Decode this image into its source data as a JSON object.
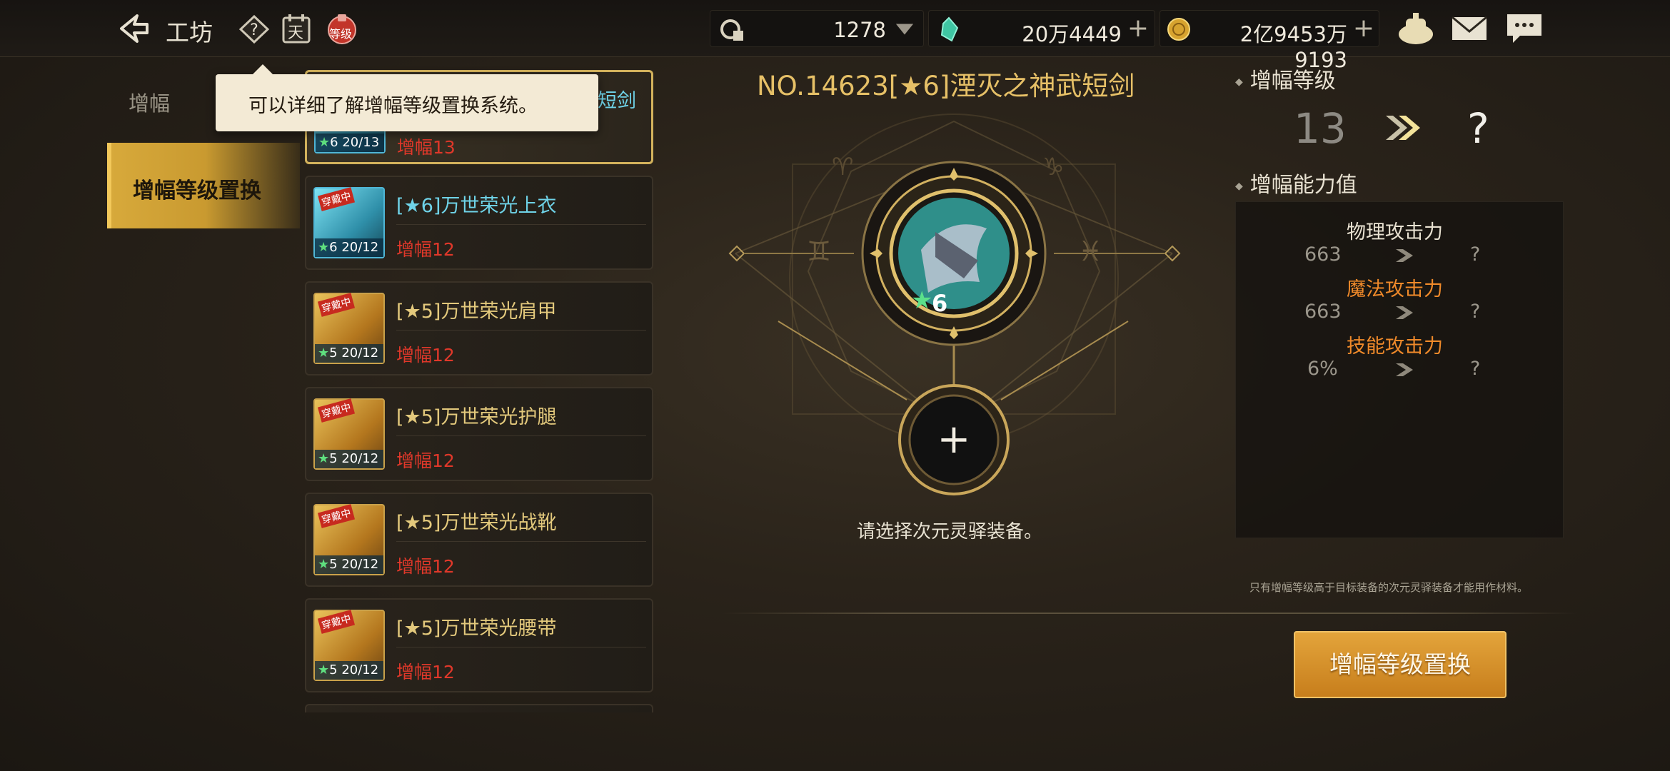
{
  "header": {
    "title": "工坊",
    "level_badge": "等级",
    "calendar_glyph": "天",
    "resources": [
      {
        "icon": "ticket-icon",
        "value": "1278"
      },
      {
        "icon": "crystal-icon",
        "value": "20万4449"
      },
      {
        "icon": "gold-coin-icon",
        "value": "2亿9453万9193"
      }
    ]
  },
  "tooltip": {
    "text": "可以详细了解增幅等级置换系统。"
  },
  "menu": {
    "tabs": [
      {
        "label": "增幅",
        "active": false
      },
      {
        "label": "增幅等级置换",
        "active": true
      }
    ]
  },
  "equipment_list": [
    {
      "name": "武短剑",
      "level": "增幅13",
      "stars": "6",
      "progress": "20/13",
      "frame": "blue",
      "selected": true
    },
    {
      "name": "[★6]万世荣光上衣",
      "level": "增幅12",
      "stars": "6",
      "progress": "20/12",
      "frame": "blue",
      "tag": "穿戴中",
      "selected": false
    },
    {
      "name": "[★5]万世荣光肩甲",
      "level": "增幅12",
      "stars": "5",
      "progress": "20/12",
      "frame": "gold",
      "tag": "穿戴中",
      "selected": false
    },
    {
      "name": "[★5]万世荣光护腿",
      "level": "增幅12",
      "stars": "5",
      "progress": "20/12",
      "frame": "gold",
      "tag": "穿戴中",
      "selected": false
    },
    {
      "name": "[★5]万世荣光战靴",
      "level": "增幅12",
      "stars": "5",
      "progress": "20/12",
      "frame": "gold",
      "tag": "穿戴中",
      "selected": false
    },
    {
      "name": "[★5]万世荣光腰带",
      "level": "增幅12",
      "stars": "5",
      "progress": "20/12",
      "frame": "gold",
      "tag": "穿戴中",
      "selected": false
    }
  ],
  "center": {
    "item_title": "NO.14623[★6]湮灭之神武短剑",
    "item_stars": "6",
    "add_symbol": "+",
    "prompt": "请选择次元灵驿装备。"
  },
  "right": {
    "level_heading": "增幅等级",
    "current_level": "13",
    "next_level": "?",
    "ability_heading": "增幅能力值",
    "stats": [
      {
        "label": "物理攻击力",
        "value": "663",
        "next": "?",
        "color": "#e9e2d2"
      },
      {
        "label": "魔法攻击力",
        "value": "663",
        "next": "?",
        "color": "#f08a2a"
      },
      {
        "label": "技能攻击力",
        "value": "6%",
        "next": "?",
        "color": "#f08a2a"
      }
    ],
    "note": "只有增幅等级高于目标装备的次元灵驿装备才能用作材料。",
    "action_label": "增幅等级置换"
  },
  "colors": {
    "accent_gold": "#d7a93b",
    "red_text": "#e0382a",
    "orange_text": "#f08a2a"
  }
}
